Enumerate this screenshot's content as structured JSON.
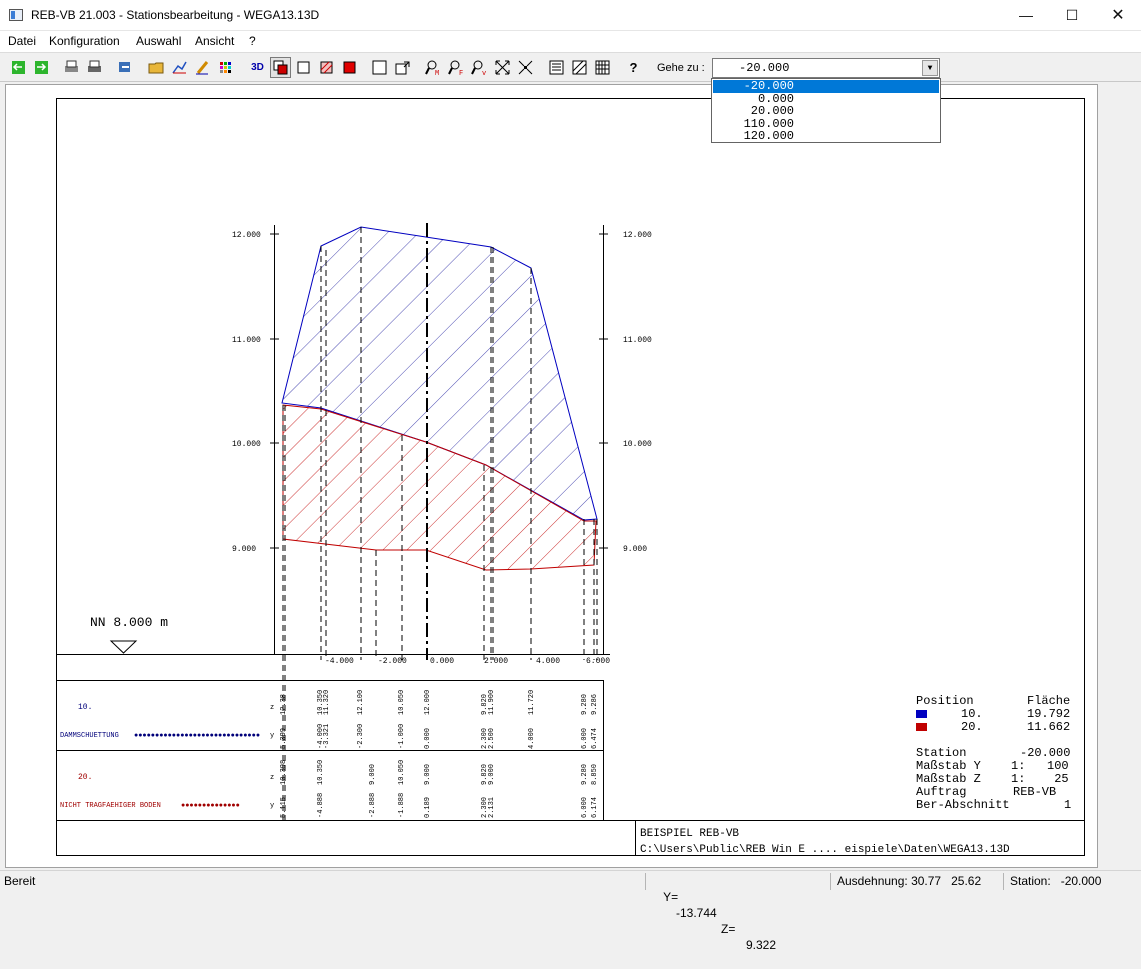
{
  "window": {
    "title": "REB-VB 21.003 - Stationsbearbeitung - WEGA13.13D"
  },
  "menu": [
    "Datei",
    "Konfiguration",
    "Auswahl",
    "Ansicht",
    "?"
  ],
  "goto": {
    "label": "Gehe zu :",
    "value": "-20.000",
    "options": [
      "-20.000",
      "0.000",
      "20.000",
      "110.000",
      "120.000"
    ]
  },
  "drawing": {
    "elev_labels": [
      "12.000",
      "11.000",
      "10.000",
      "9.000"
    ],
    "datum": "NN    8.000 m",
    "x_labels": [
      "-4.000",
      "-2.000",
      "0.000",
      "2.000",
      "4.000",
      "6.000"
    ],
    "table": {
      "layer1": {
        "pos": "10.",
        "name": "DAMMSCHUETTUNG",
        "z_vals": [
          "12.38",
          "10.350",
          "11.320",
          "12.100",
          "10.050",
          "12.000",
          "9.820",
          "11.900",
          "11.720",
          "9.280",
          "9.286"
        ],
        "y_vals": [
          "5.399",
          "-4.000",
          "-3.321",
          "-2.300",
          "-1.000",
          "0.000",
          "2.300",
          "2.500",
          "4.000",
          "6.000",
          "6.474"
        ]
      },
      "layer2": {
        "pos": "20.",
        "name": "NICHT TRAGFAEHIGER BODEN",
        "z_vals": [
          "10.398",
          "10.350",
          "9.000",
          "10.050",
          "9.000",
          "9.820",
          "9.000",
          "9.280",
          "8.850"
        ],
        "y_vals": [
          "5.115",
          "-4.888",
          "-2.888",
          "-1.888",
          "0.189",
          "2.300",
          "2.131",
          "6.000",
          "6.174"
        ]
      },
      "row_z": "z",
      "row_y": "y"
    },
    "legend": {
      "head_pos": "Position",
      "head_area": "Fläche",
      "rows": [
        {
          "pos": "10.",
          "area": "19.792",
          "color": "#0000c0"
        },
        {
          "pos": "20.",
          "area": "11.662",
          "color": "#c00000"
        }
      ]
    },
    "info": [
      {
        "k": "Station",
        "v": "-20.000"
      },
      {
        "k": "Maßstab Y",
        "v": "1:   100"
      },
      {
        "k": "Maßstab Z",
        "v": "1:    25"
      },
      {
        "k": "Auftrag",
        "v": "REB-VB"
      },
      {
        "k": "Ber-Abschnitt",
        "v": "1"
      }
    ],
    "footer1": "BEISPIEL REB-VB",
    "footer2": "C:\\Users\\Public\\REB Win E .... eispiele\\Daten\\WEGA13.13D"
  },
  "status": {
    "ready": "Bereit",
    "y_label": "Y=",
    "y_value": "-13.744",
    "z_label": "Z=",
    "z_value": "9.322",
    "extent": "Ausdehnung: 30.77   25.62",
    "station": "Station:   -20.000"
  },
  "colors": {
    "layer1": "#0000c0",
    "layer2": "#c00000",
    "selection": "#0078d7"
  }
}
